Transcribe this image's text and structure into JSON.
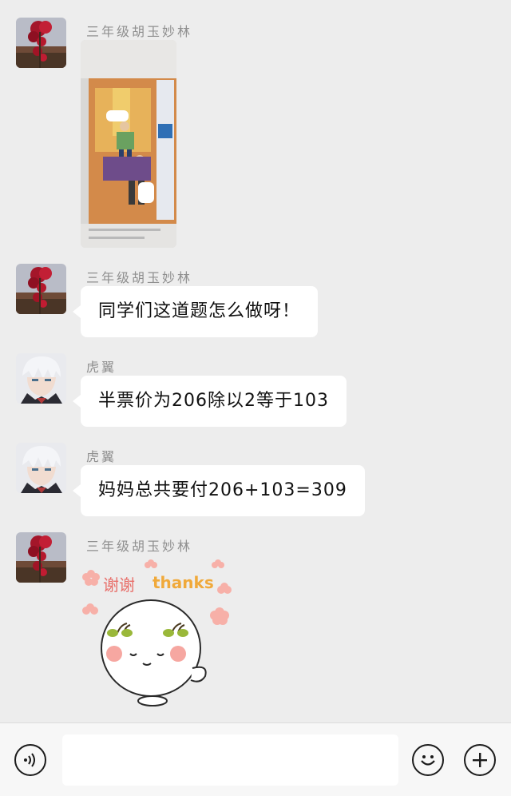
{
  "messages": [
    {
      "sender": "三年级胡玉妙林",
      "type": "image",
      "avatar": "red-flower-avatar-icon"
    },
    {
      "sender": "三年级胡玉妙林",
      "type": "text",
      "text": "同学们这道题怎么做呀！",
      "avatar": "red-flower-avatar-icon"
    },
    {
      "sender": "虎翼",
      "type": "text",
      "text": "半票价为206除以2等于103",
      "avatar": "anime-boy-avatar-icon"
    },
    {
      "sender": "虎翼",
      "type": "text",
      "text": "妈妈总共要付206+103=309",
      "avatar": "anime-boy-avatar-icon"
    },
    {
      "sender": "三年级胡玉妙林",
      "type": "sticker",
      "avatar": "red-flower-avatar-icon"
    }
  ],
  "sticker": {
    "cn_text": "谢谢",
    "en_text": "thanks"
  },
  "input": {
    "value": "",
    "placeholder": ""
  },
  "icons": {
    "voice": "voice-icon",
    "emoji": "emoji-icon",
    "plus": "plus-icon"
  },
  "colors": {
    "background": "#ededed",
    "bubble": "#ffffff",
    "sender_text": "#8f8f8f",
    "bottom_bar": "#f7f7f7"
  }
}
